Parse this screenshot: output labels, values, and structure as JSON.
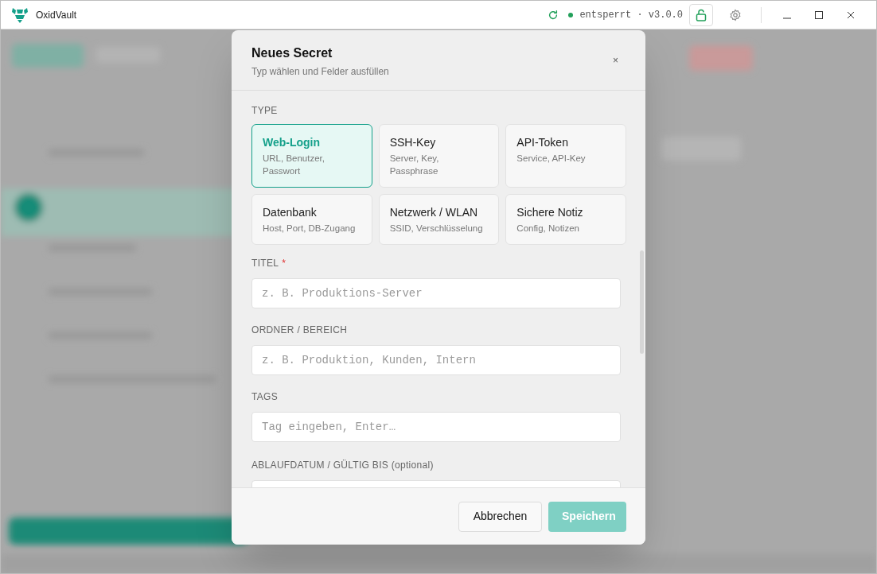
{
  "window": {
    "title": "OxidVault",
    "status": "entsperrt · v3.0.0",
    "unlocked": true
  },
  "dialog": {
    "title": "Neues Secret",
    "subtitle": "Typ wählen und Felder ausfüllen",
    "close": "×",
    "type_label": "TYPE",
    "types": [
      {
        "name": "Web-Login",
        "desc": "URL, Benutzer, Passwort",
        "selected": true
      },
      {
        "name": "SSH-Key",
        "desc": "Server, Key, Passphrase",
        "selected": false
      },
      {
        "name": "API-Token",
        "desc": "Service, API-Key",
        "selected": false
      },
      {
        "name": "Datenbank",
        "desc": "Host, Port, DB-Zugang",
        "selected": false
      },
      {
        "name": "Netzwerk / WLAN",
        "desc": "SSID, Verschlüsselung",
        "selected": false
      },
      {
        "name": "Sichere Notiz",
        "desc": "Config, Notizen",
        "selected": false
      }
    ],
    "fields": [
      {
        "label": "TITEL",
        "required_mark": "*",
        "placeholder": "z. B. Produktions-Server"
      },
      {
        "label": "ORDNER / BEREICH",
        "placeholder": "z. B. Produktion, Kunden, Intern"
      },
      {
        "label": "TAGS",
        "placeholder": "Tag eingeben, Enter…"
      },
      {
        "label": "ABLAUFDATUM / GÜLTIG BIS (optional)"
      }
    ],
    "buttons": [
      {
        "label": "Abbrechen",
        "kind": "secondary",
        "disabled": false
      },
      {
        "label": "Speichern",
        "kind": "primary",
        "disabled": true
      }
    ]
  }
}
